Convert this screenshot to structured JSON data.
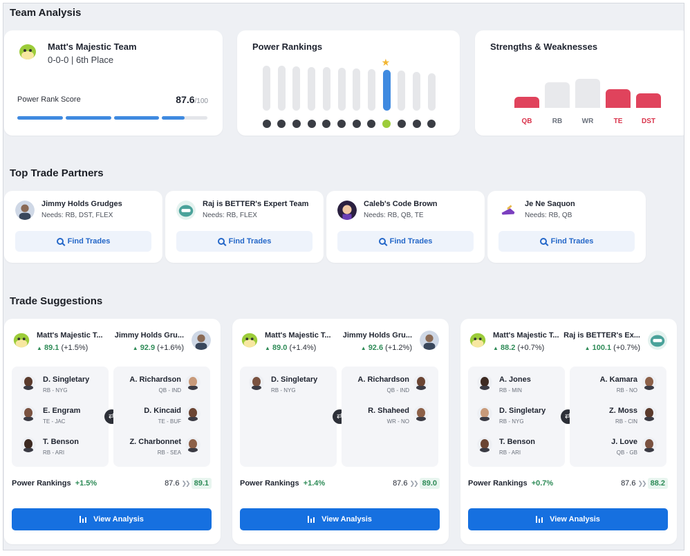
{
  "header": {
    "title": "Team Analysis"
  },
  "team": {
    "name": "Matt's Majestic Team",
    "record": "0-0-0 | 6th Place",
    "power_rank_label": "Power Rank Score",
    "power_rank_score": "87.6",
    "power_rank_max": "/100",
    "power_rank_fraction": 0.876
  },
  "power_rankings": {
    "title": "Power Rankings",
    "levels": [
      0.9,
      0.9,
      0.89,
      0.88,
      0.87,
      0.86,
      0.85,
      0.84,
      0.82,
      0.8,
      0.78,
      0.75
    ],
    "highlight_index": 8
  },
  "strengths": {
    "title": "Strengths & Weaknesses",
    "positions": [
      {
        "label": "QB",
        "level": 0.3,
        "weak": true
      },
      {
        "label": "RB",
        "level": 0.72,
        "weak": false
      },
      {
        "label": "WR",
        "level": 0.8,
        "weak": false
      },
      {
        "label": "TE",
        "level": 0.51,
        "weak": true
      },
      {
        "label": "DST",
        "level": 0.41,
        "weak": true
      }
    ],
    "colors": {
      "weak": "#e0435c",
      "neutral": "#e8e9ec"
    }
  },
  "partners_section": {
    "title": "Top Trade Partners"
  },
  "partners": [
    {
      "name": "Jimmy Holds Grudges",
      "needs": "Needs: RB, DST, FLEX",
      "button": "Find Trades"
    },
    {
      "name": "Raj is BETTER's Expert Team",
      "needs": "Needs: RB, FLEX",
      "button": "Find Trades"
    },
    {
      "name": "Caleb's Code Brown",
      "needs": "Needs: RB, QB, TE",
      "button": "Find Trades"
    },
    {
      "name": "Je Ne Saquon",
      "needs": "Needs: RB, QB",
      "button": "Find Trades"
    }
  ],
  "suggestions_section": {
    "title": "Trade Suggestions"
  },
  "suggestions": [
    {
      "left_team": "Matt's Majestic T...",
      "left_score": "89.1",
      "left_delta": "(+1.5%)",
      "right_team": "Jimmy Holds Gru...",
      "right_score": "92.9",
      "right_delta": "(+1.6%)",
      "give": [
        {
          "name": "D. Singletary",
          "pos": "RB - NYG"
        },
        {
          "name": "E. Engram",
          "pos": "TE - JAC"
        },
        {
          "name": "T. Benson",
          "pos": "RB - ARI"
        }
      ],
      "get": [
        {
          "name": "A. Richardson",
          "pos": "QB - IND"
        },
        {
          "name": "D. Kincaid",
          "pos": "TE - BUF"
        },
        {
          "name": "Z. Charbonnet",
          "pos": "RB - SEA"
        }
      ],
      "pr_label": "Power Rankings",
      "pr_delta": "+1.5%",
      "pr_old": "87.6",
      "pr_new": "89.1",
      "button": "View Analysis"
    },
    {
      "left_team": "Matt's Majestic T...",
      "left_score": "89.0",
      "left_delta": "(+1.4%)",
      "right_team": "Jimmy Holds Gru...",
      "right_score": "92.6",
      "right_delta": "(+1.2%)",
      "give": [
        {
          "name": "D. Singletary",
          "pos": "RB - NYG"
        }
      ],
      "get": [
        {
          "name": "A. Richardson",
          "pos": "QB - IND"
        },
        {
          "name": "R. Shaheed",
          "pos": "WR - NO"
        }
      ],
      "pr_label": "Power Rankings",
      "pr_delta": "+1.4%",
      "pr_old": "87.6",
      "pr_new": "89.0",
      "button": "View Analysis"
    },
    {
      "left_team": "Matt's Majestic T...",
      "left_score": "88.2",
      "left_delta": "(+0.7%)",
      "right_team": "Raj is BETTER's Ex...",
      "right_score": "100.1",
      "right_delta": "(+0.7%)",
      "give": [
        {
          "name": "A. Jones",
          "pos": "RB - MIN"
        },
        {
          "name": "D. Singletary",
          "pos": "RB - NYG"
        },
        {
          "name": "T. Benson",
          "pos": "RB - ARI"
        }
      ],
      "get": [
        {
          "name": "A. Kamara",
          "pos": "RB - NO"
        },
        {
          "name": "Z. Moss",
          "pos": "RB - CIN"
        },
        {
          "name": "J. Love",
          "pos": "QB - GB"
        }
      ],
      "pr_label": "Power Rankings",
      "pr_delta": "+0.7%",
      "pr_old": "87.6",
      "pr_new": "88.2",
      "button": "View Analysis"
    }
  ]
}
